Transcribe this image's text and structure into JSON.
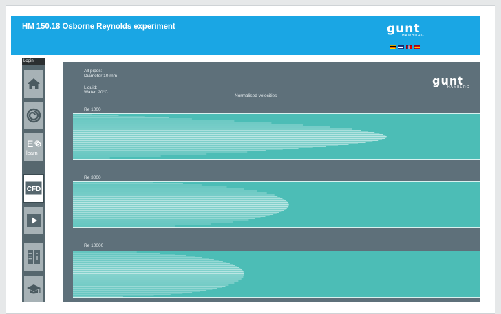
{
  "header": {
    "title": "HM 150.18 Osborne Reynolds experiment",
    "logo_text": "gunt",
    "logo_sub": "HAMBURG",
    "languages": [
      "de",
      "en",
      "fr",
      "es"
    ],
    "accent_color": "#1aa6e4"
  },
  "login": {
    "label": "Login"
  },
  "sidebar": {
    "items": [
      {
        "icon": "home-icon",
        "active": false
      },
      {
        "icon": "swirl-icon",
        "active": false
      },
      {
        "icon": "elearn-icon",
        "label_top": "E",
        "label_bottom": "learn",
        "active": false
      },
      {
        "icon": "cfd-icon",
        "label": "CFD",
        "active": true
      },
      {
        "icon": "play-icon",
        "active": false
      },
      {
        "icon": "info-book-icon",
        "active": false
      },
      {
        "icon": "graduation-cap-icon",
        "active": false
      }
    ]
  },
  "panel": {
    "pipes_label": "All pipes:",
    "pipes_diameter": "Diameter 10 mm",
    "liquid_label": "Liquid:",
    "liquid_value": "Water, 20°C",
    "heading": "Normalised velocities",
    "logo_text": "gunt",
    "logo_sub": "HAMBURG",
    "profiles": [
      {
        "label": "Re 1000",
        "extent": 0.77
      },
      {
        "label": "Re 3000",
        "extent": 0.53
      },
      {
        "label": "Re 10000",
        "extent": 0.42
      }
    ],
    "flow_color": "#4cbdb6",
    "panel_color": "#5e707a"
  }
}
